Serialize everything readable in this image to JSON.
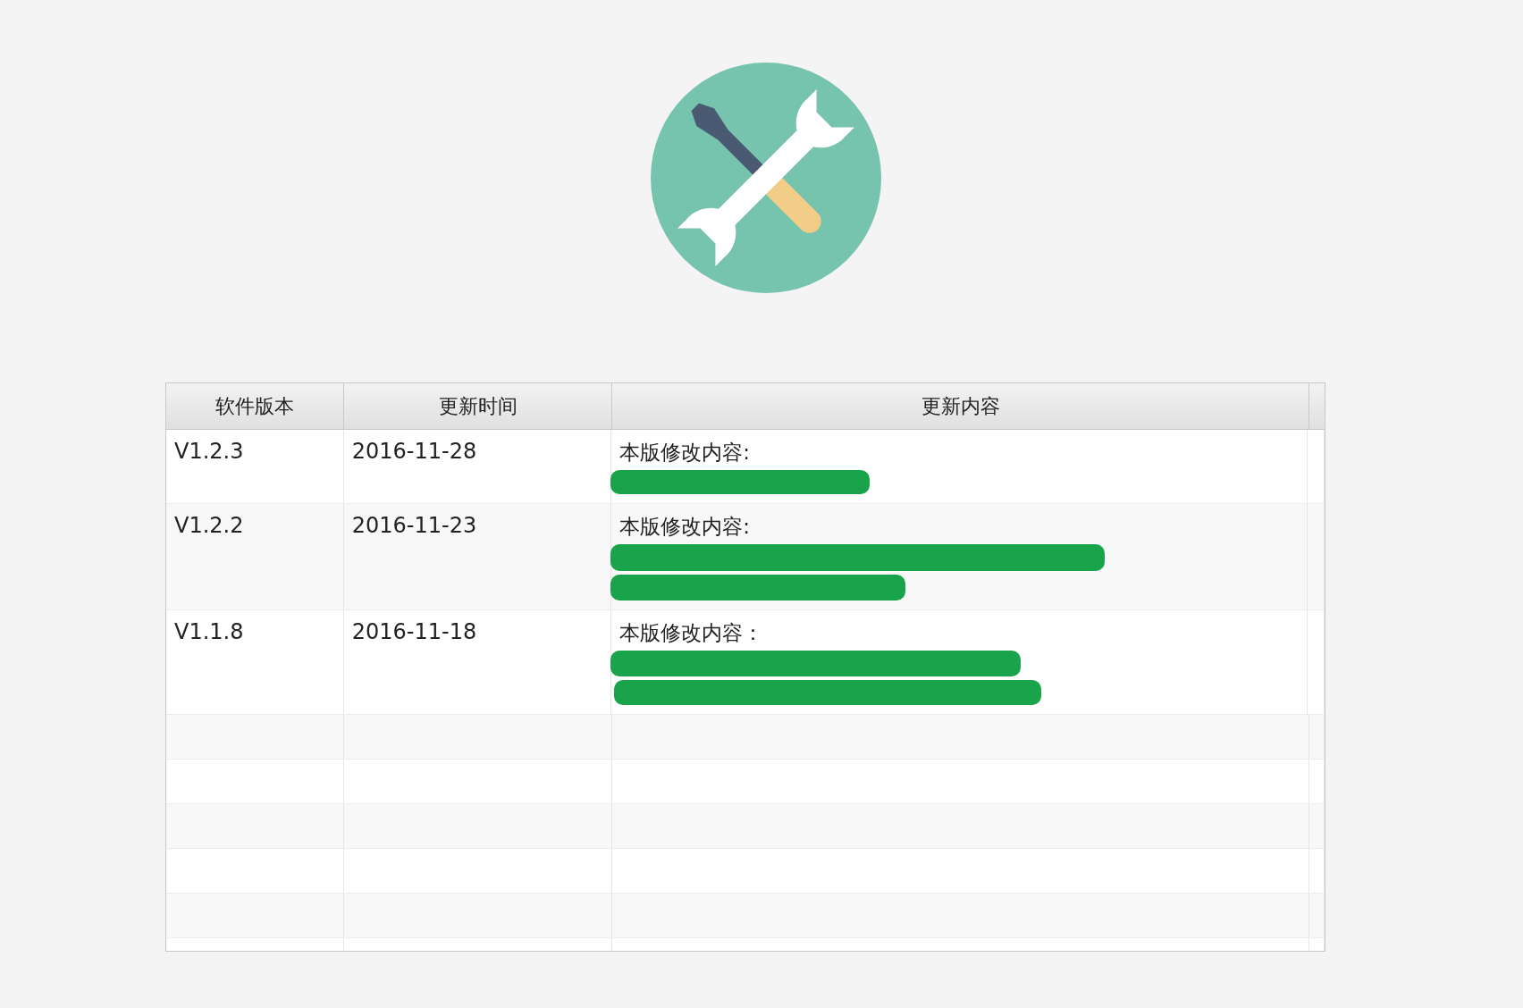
{
  "table": {
    "columns": [
      "软件版本",
      "更新时间",
      "更新内容"
    ],
    "rows": [
      {
        "version": "V1.2.3",
        "date": "2016-11-28",
        "content_heading": "本版修改内容:",
        "lines": [
          {
            "kind": "redacted"
          }
        ]
      },
      {
        "version": "V1.2.2",
        "date": "2016-11-23",
        "content_heading": "本版修改内容:",
        "lines": [
          {
            "kind": "redacted"
          },
          {
            "kind": "redacted"
          }
        ]
      },
      {
        "version": "V1.1.8",
        "date": "2016-11-18",
        "content_heading": "本版修改内容：",
        "lines": [
          {
            "kind": "redacted"
          },
          {
            "kind": "redacted"
          }
        ]
      }
    ]
  }
}
